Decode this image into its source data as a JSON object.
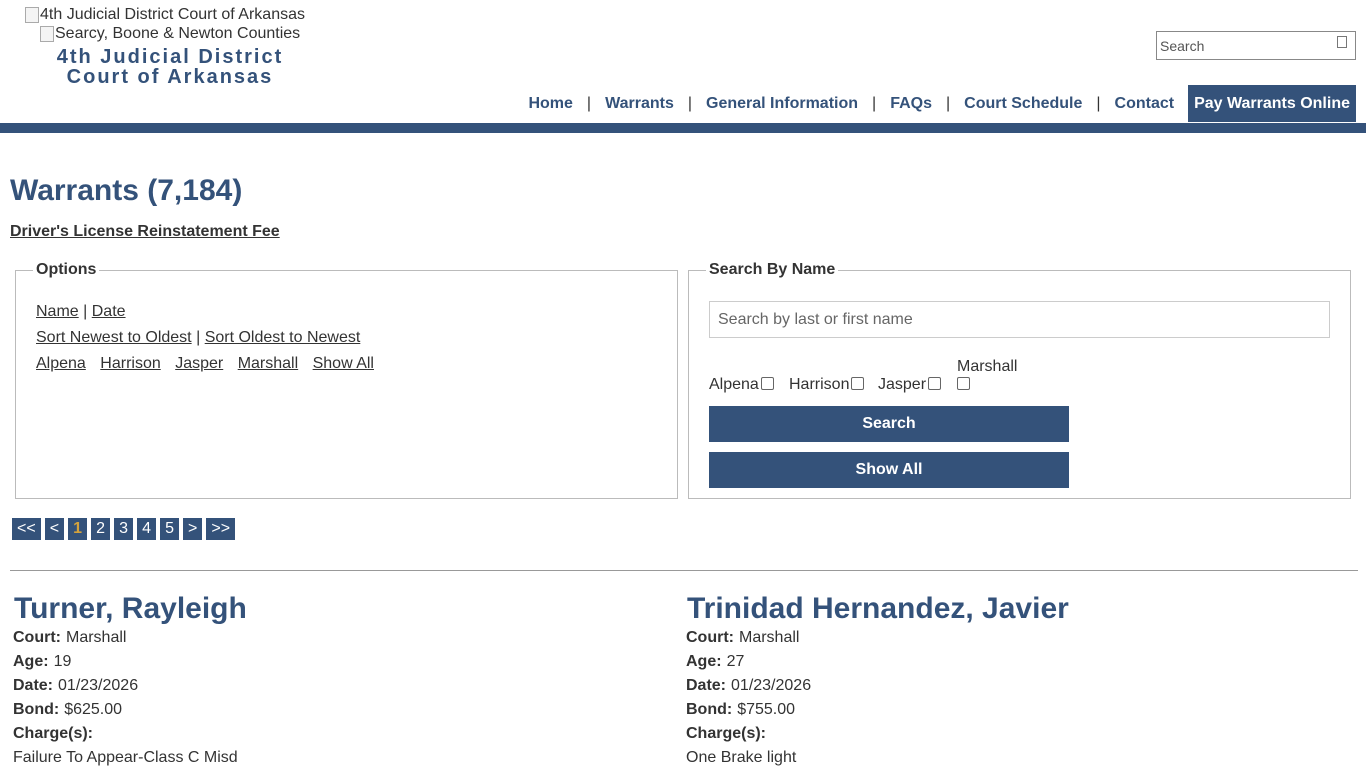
{
  "header": {
    "logo_alt": "4th Judicial District Court of Arkansas",
    "counties_alt": "Searcy, Boone & Newton Counties",
    "title_line1": "4th Judicial District",
    "title_line2": "Court of Arkansas",
    "search_placeholder": "Search"
  },
  "nav": {
    "items": [
      "Home",
      "Warrants",
      "General Information",
      "FAQs",
      "Court Schedule",
      "Contact"
    ],
    "separator": "|",
    "pay_label": "Pay Warrants Online"
  },
  "page": {
    "title": "Warrants (7,184)",
    "dl_link": "Driver's License Reinstatement Fee"
  },
  "options": {
    "legend": "Options",
    "sort_name": "Name",
    "sort_date": "Date",
    "pipe": "|",
    "newest": "Sort Newest to Oldest",
    "oldest": "Sort Oldest to Newest",
    "courts": [
      "Alpena",
      "Harrison",
      "Jasper",
      "Marshall",
      "Show All"
    ]
  },
  "search_by_name": {
    "legend": "Search By Name",
    "placeholder": "Search by last or first name",
    "checkboxes": [
      "Alpena",
      "Harrison",
      "Jasper",
      "Marshall"
    ],
    "search_button": "Search",
    "show_all_button": "Show All"
  },
  "pagination": {
    "first": "<<",
    "prev": "<",
    "pages": [
      "1",
      "2",
      "3",
      "4",
      "5"
    ],
    "current": "1",
    "next": ">",
    "last": ">>"
  },
  "labels": {
    "court": "Court:",
    "age": "Age:",
    "date": "Date:",
    "bond": "Bond:",
    "charges": "Charge(s):"
  },
  "warrants": [
    {
      "name": "Turner, Rayleigh",
      "court": "Marshall",
      "age": "19",
      "date": "01/23/2026",
      "bond": "$625.00",
      "charge": "Failure To Appear-Class C Misd"
    },
    {
      "name": "Trinidad Hernandez, Javier",
      "court": "Marshall",
      "age": "27",
      "date": "01/23/2026",
      "bond": "$755.00",
      "charge": "One Brake light"
    }
  ],
  "colors": {
    "brand": "#34527a",
    "active_page": "#d4a23c"
  }
}
